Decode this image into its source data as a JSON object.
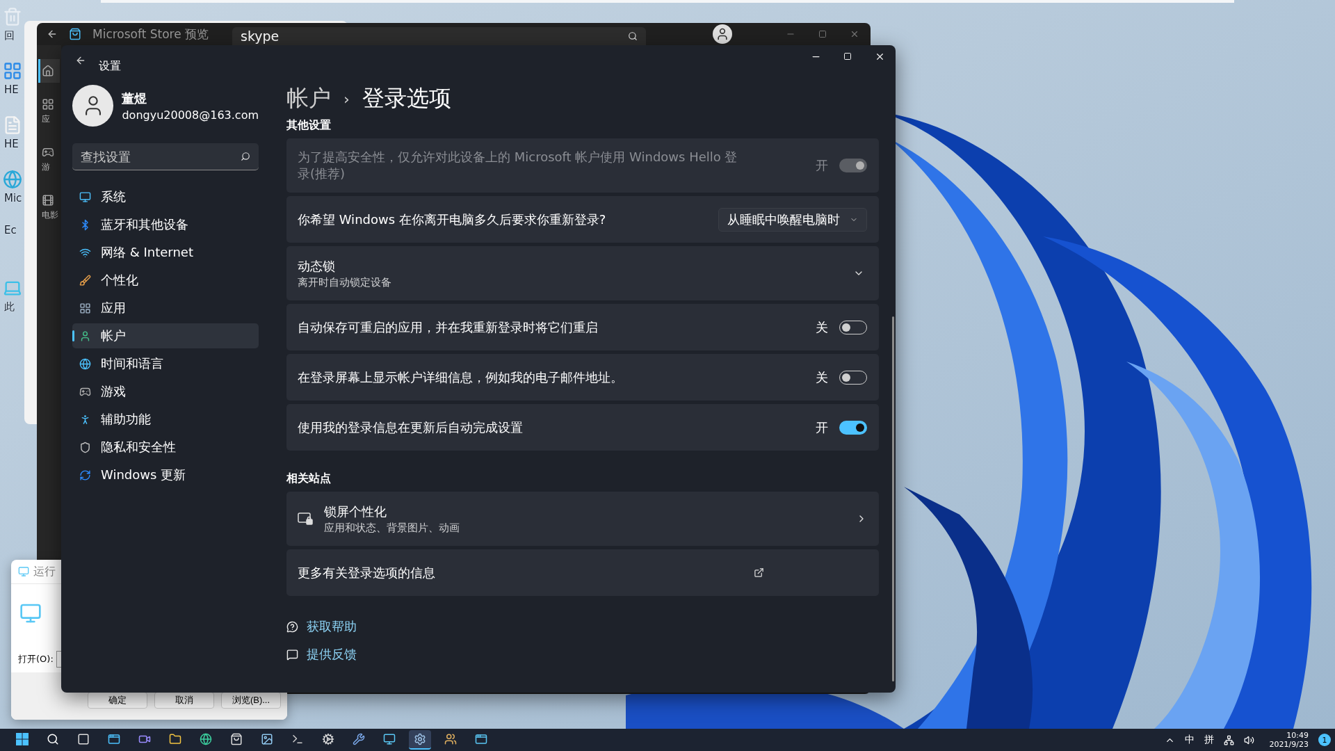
{
  "desktop": {
    "icons": [
      {
        "kind": "recycle",
        "label": "回"
      },
      {
        "kind": "app",
        "label": "HE"
      },
      {
        "kind": "doc",
        "label": "HE"
      },
      {
        "kind": "edge",
        "label": "Mic"
      },
      {
        "kind": "none",
        "label": "Ec"
      },
      {
        "kind": "pc",
        "label": "此"
      }
    ]
  },
  "store_window": {
    "title": "Microsoft Store 预览",
    "search": {
      "value": "skype"
    },
    "nav_items": [
      {
        "kind": "home",
        "selected": true
      },
      {
        "kind": "apps",
        "label": "应",
        "selected": false
      },
      {
        "kind": "games",
        "label": "游",
        "selected": false
      },
      {
        "kind": "movies",
        "label": "电影",
        "selected": false
      }
    ]
  },
  "run_dialog": {
    "title": "运行",
    "open_label": "打开(O):",
    "buttons": [
      "确定",
      "取消",
      "浏览(B)..."
    ]
  },
  "settings": {
    "title": "设置",
    "user": {
      "name": "董煜",
      "email": "dongyu20008@163.com"
    },
    "search": {
      "placeholder": "查找设置"
    },
    "nav_items": [
      {
        "kind": "system",
        "label": "系统",
        "selected": false
      },
      {
        "kind": "bluetooth",
        "label": "蓝牙和其他设备",
        "selected": false
      },
      {
        "kind": "network",
        "label": "网络 & Internet",
        "selected": false
      },
      {
        "kind": "personalize",
        "label": "个性化",
        "selected": false
      },
      {
        "kind": "apps",
        "label": "应用",
        "selected": false
      },
      {
        "kind": "accounts",
        "label": "帐户",
        "selected": true
      },
      {
        "kind": "time",
        "label": "时间和语言",
        "selected": false
      },
      {
        "kind": "gaming",
        "label": "游戏",
        "selected": false
      },
      {
        "kind": "accessibility",
        "label": "辅助功能",
        "selected": false
      },
      {
        "kind": "privacy",
        "label": "隐私和安全性",
        "selected": false
      },
      {
        "kind": "update",
        "label": "Windows 更新",
        "selected": false
      }
    ],
    "breadcrumb": [
      "帐户",
      "›",
      "登录选项"
    ],
    "other_settings_heading": "其他设置",
    "other_settings": [
      {
        "kind": "toggle",
        "text": "为了提高安全性，仅允许对此设备上的 Microsoft 帐户使用 Windows Hello 登录(推荐)",
        "state_label": "开",
        "on": true,
        "disabled": true
      },
      {
        "kind": "dropdown",
        "text": "你希望 Windows 在你离开电脑多久后要求你重新登录?",
        "value": "从睡眠中唤醒电脑时"
      },
      {
        "kind": "expander",
        "title": "动态锁",
        "subtitle": "离开时自动锁定设备",
        "expanded": false
      },
      {
        "kind": "toggle",
        "text": "自动保存可重启的应用，并在我重新登录时将它们重启",
        "state_label": "关",
        "on": false,
        "disabled": false
      },
      {
        "kind": "toggle",
        "text": "在登录屏幕上显示帐户详细信息，例如我的电子邮件地址。",
        "state_label": "关",
        "on": false,
        "disabled": false
      },
      {
        "kind": "toggle",
        "text": "使用我的登录信息在更新后自动完成设置",
        "state_label": "开",
        "on": true,
        "disabled": false
      }
    ],
    "related_heading": "相关站点",
    "related": [
      {
        "kind": "link_card",
        "title": "锁屏个性化",
        "subtitle": "应用和状态、背景图片、动画"
      },
      {
        "kind": "external",
        "title": "更多有关登录选项的信息"
      }
    ],
    "help_links": [
      {
        "kind": "help",
        "label": "获取帮助"
      },
      {
        "kind": "feedback",
        "label": "提供反馈"
      }
    ]
  },
  "taskbar": {
    "apps": [
      {
        "kind": "start",
        "selected": false
      },
      {
        "kind": "search",
        "selected": false
      },
      {
        "kind": "taskview",
        "selected": false
      },
      {
        "kind": "widgets",
        "selected": false
      },
      {
        "kind": "chat",
        "selected": false
      },
      {
        "kind": "folder",
        "selected": false
      },
      {
        "kind": "edge",
        "selected": false
      },
      {
        "kind": "store",
        "selected": false
      },
      {
        "kind": "photos",
        "selected": false
      },
      {
        "kind": "terminal",
        "selected": false
      },
      {
        "kind": "gears",
        "selected": false
      },
      {
        "kind": "tool",
        "selected": false
      },
      {
        "kind": "display",
        "selected": false
      },
      {
        "kind": "settings",
        "selected": true
      },
      {
        "kind": "people",
        "selected": false
      },
      {
        "kind": "run",
        "selected": false
      }
    ],
    "tray": {
      "ime_mode": "中",
      "ime_name": "拼",
      "time": "10:49",
      "date": "2021/9/23",
      "notifications": "1"
    }
  }
}
